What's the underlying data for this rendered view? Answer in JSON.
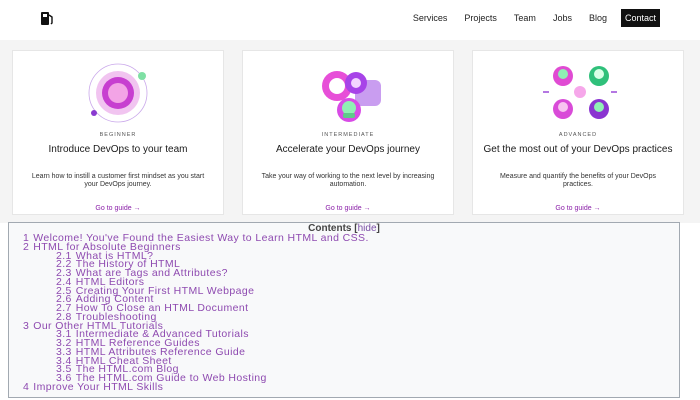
{
  "nav": {
    "logo_icon": "fuel-pump-icon",
    "links": [
      "Services",
      "Projects",
      "Team",
      "Jobs",
      "Blog"
    ],
    "contact": "Contact"
  },
  "colors": {
    "accent": "#8a1ea8",
    "toc_link": "#8e4ab0",
    "card_bg": "#f4f4f4"
  },
  "cards": [
    {
      "level": "BEGINNER",
      "title": "Introduce DevOps to your team",
      "desc": "Learn how to instill a customer first mindset as you start your DevOps journey.",
      "link": "Go to guide →"
    },
    {
      "level": "INTERMEDIATE",
      "title": "Accelerate your DevOps journey",
      "desc": "Take your way of working to the next level by increasing automation.",
      "link": "Go to guide →"
    },
    {
      "level": "ADVANCED",
      "title": "Get the most out of your DevOps practices",
      "desc": "Measure and quantify the benefits of your DevOps practices.",
      "link": "Go to guide →"
    }
  ],
  "toc": {
    "title": "Contents",
    "hide": "hide",
    "items": [
      {
        "num": "1",
        "text": "Welcome! You've Found the Easiest Way to Learn HTML and CSS.",
        "level": 1
      },
      {
        "num": "2",
        "text": "HTML for Absolute Beginners",
        "level": 1
      },
      {
        "num": "2.1",
        "text": "What is HTML?",
        "level": 2
      },
      {
        "num": "2.2",
        "text": "The History of HTML",
        "level": 2
      },
      {
        "num": "2.3",
        "text": "What are Tags and Attributes?",
        "level": 2
      },
      {
        "num": "2.4",
        "text": "HTML Editors",
        "level": 2
      },
      {
        "num": "2.5",
        "text": "Creating Your First HTML Webpage",
        "level": 2
      },
      {
        "num": "2.6",
        "text": "Adding Content",
        "level": 2
      },
      {
        "num": "2.7",
        "text": "How To Close an HTML Document",
        "level": 2
      },
      {
        "num": "2.8",
        "text": "Troubleshooting",
        "level": 2
      },
      {
        "num": "3",
        "text": "Our Other HTML Tutorials",
        "level": 1
      },
      {
        "num": "3.1",
        "text": "Intermediate & Advanced Tutorials",
        "level": 2
      },
      {
        "num": "3.2",
        "text": "HTML Reference Guides",
        "level": 2
      },
      {
        "num": "3.3",
        "text": "HTML Attributes Reference Guide",
        "level": 2
      },
      {
        "num": "3.4",
        "text": "HTML Cheat Sheet",
        "level": 2
      },
      {
        "num": "3.5",
        "text": "The HTML.com Blog",
        "level": 2
      },
      {
        "num": "3.6",
        "text": "The HTML.com Guide to Web Hosting",
        "level": 2
      },
      {
        "num": "4",
        "text": "Improve Your HTML Skills",
        "level": 1
      }
    ]
  }
}
